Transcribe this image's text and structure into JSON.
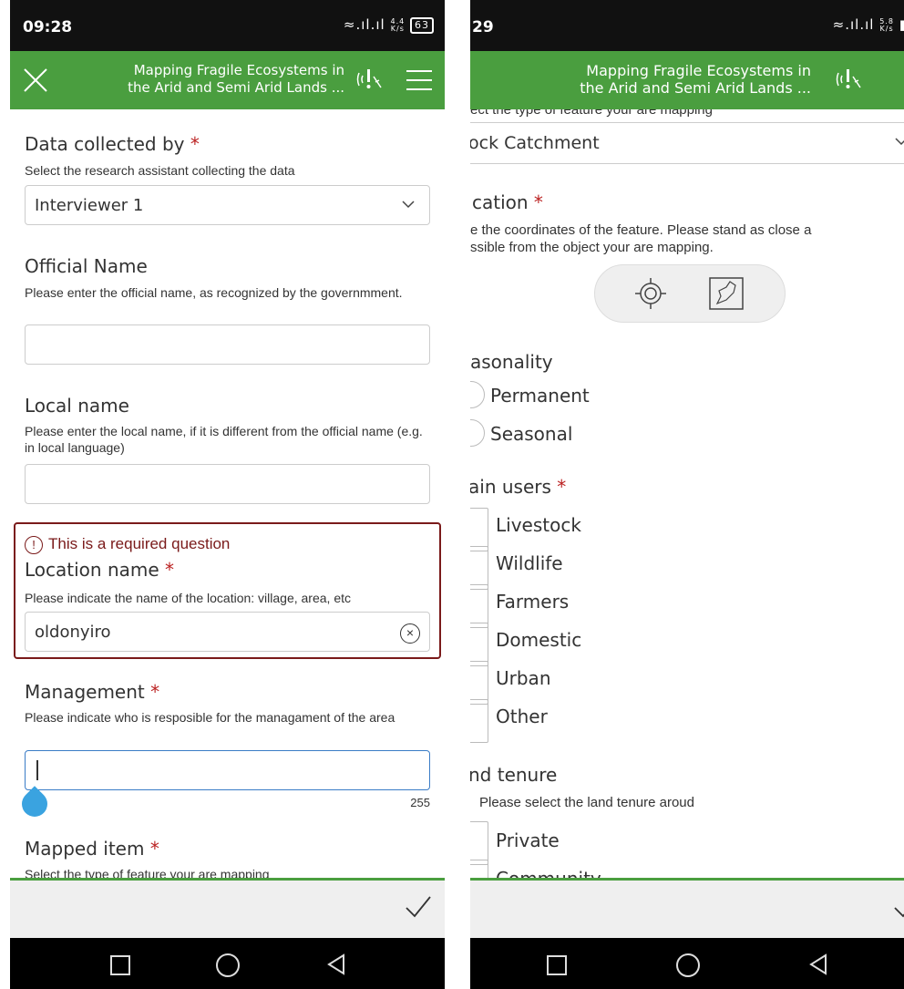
{
  "left": {
    "status": {
      "time": "09:28",
      "speed": "4.4\nK/s",
      "battery": "63"
    },
    "appbar": {
      "title_line1": "Mapping Fragile Ecosystems in",
      "title_line2": "the Arid and Semi Arid Lands ..."
    },
    "questions": {
      "data_collected": {
        "label": "Data collected by",
        "required": "*",
        "hint": "Select the research assistant collecting the data",
        "value": "Interviewer 1"
      },
      "official_name": {
        "label": "Official Name",
        "hint": "Please enter the official name, as recognized by the governmment.",
        "value": ""
      },
      "local_name": {
        "label": "Local name",
        "hint": "Please enter the local name, if it is different from the official name (e.g. in local language)",
        "value": ""
      },
      "location_name": {
        "error": "This is a required question",
        "label": "Location name",
        "required": "*",
        "hint": "Please indicate the name of the location: village, area, etc",
        "value": "oldonyiro"
      },
      "management": {
        "label": "Management",
        "required": "*",
        "hint": "Please indicate who is resposible for the managament of the area",
        "value": "",
        "char_counter": "255"
      },
      "mapped_item": {
        "label": "Mapped item",
        "required": "*",
        "hint": "Select the type of feature your are mapping"
      }
    }
  },
  "right": {
    "status": {
      "time": "29",
      "speed": "5.8\nK/s"
    },
    "appbar": {
      "title_line1": "Mapping Fragile Ecosystems in",
      "title_line2": "the Arid and Semi Arid Lands ..."
    },
    "top_hint": "ect the type of feature your are mapping",
    "mapped_value": "ock Catchment",
    "location": {
      "label": "cation",
      "required": "*",
      "hint_line1": "e the coordinates of the feature. Please stand as close a",
      "hint_line2": "ssible from the object your are mapping."
    },
    "seasonality": {
      "label": "asonality",
      "options": [
        "Permanent",
        "Seasonal"
      ]
    },
    "main_users": {
      "label": "ain users",
      "required": "*",
      "options": [
        "Livestock",
        "Wildlife",
        "Farmers",
        "Domestic",
        "Urban",
        "Other"
      ]
    },
    "land_tenure": {
      "label": "nd tenure",
      "hint": "Please select the land tenure aroud",
      "options": [
        "Private",
        "Community"
      ]
    }
  },
  "colors": {
    "appbar": "#4a9e3f",
    "error": "#7a1a1a",
    "required": "#b22222",
    "focus": "#3a7cc6"
  }
}
